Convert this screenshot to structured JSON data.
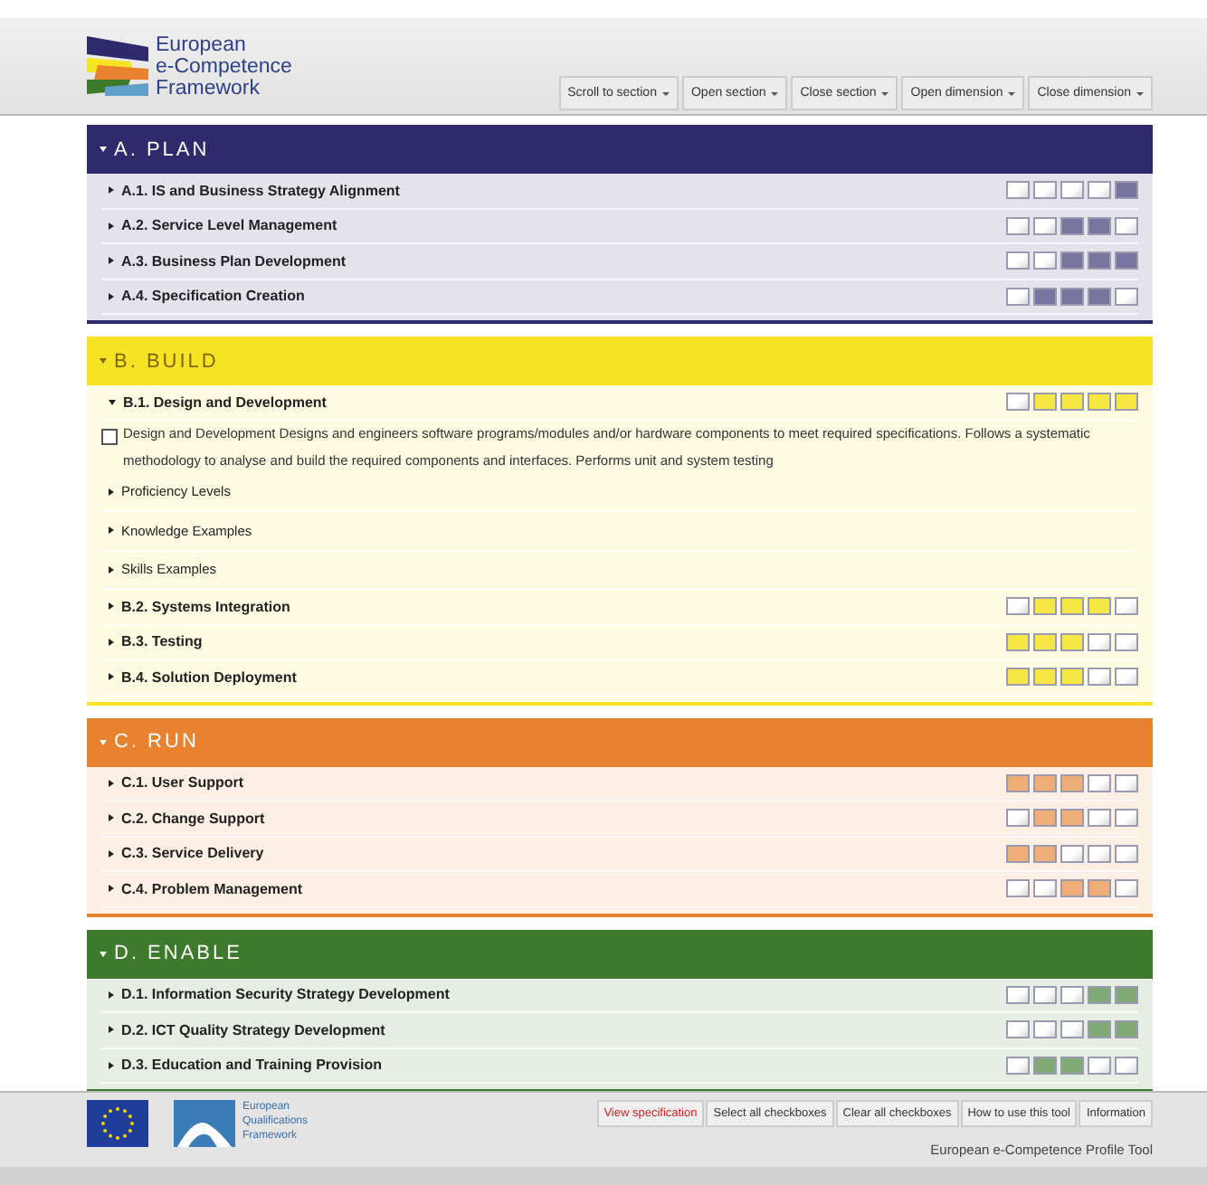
{
  "header": {
    "logo_lines": [
      "European",
      "e-Competence",
      "Framework"
    ],
    "menu_buttons": [
      "Scroll to section",
      "Open section",
      "Close section",
      "Open dimension",
      "Close dimension"
    ]
  },
  "sections": [
    {
      "title": "A. PLAN",
      "color": "#2e2a6b",
      "expanded": true,
      "items": [
        {
          "title": "A.1. IS and Business Strategy Alignment",
          "expanded": false,
          "levels": [
            false,
            false,
            false,
            false,
            true
          ]
        },
        {
          "title": "A.2. Service Level Management",
          "expanded": false,
          "levels": [
            false,
            false,
            true,
            true,
            false
          ]
        },
        {
          "title": "A.3. Business Plan Development",
          "expanded": false,
          "levels": [
            false,
            false,
            true,
            true,
            true
          ]
        },
        {
          "title": "A.4. Specification Creation",
          "expanded": false,
          "levels": [
            false,
            true,
            true,
            true,
            false
          ]
        }
      ]
    },
    {
      "title": "B. BUILD",
      "color": "#f5e324",
      "expanded": true,
      "items": [
        {
          "title": "B.1. Design and Development",
          "expanded": true,
          "levels": [
            false,
            true,
            true,
            true,
            true
          ],
          "description": "Design and Development Designs and engineers software programs/modules and/or hardware components to meet required specifications. Follows a systematic methodology to analyse and build the required components and interfaces. Performs unit and system testing",
          "description_checked": false,
          "subsections": [
            "Proficiency Levels",
            "Knowledge Examples",
            "Skills Examples"
          ]
        },
        {
          "title": "B.2. Systems Integration",
          "expanded": false,
          "levels": [
            false,
            true,
            true,
            true,
            false
          ]
        },
        {
          "title": "B.3. Testing",
          "expanded": false,
          "levels": [
            true,
            true,
            true,
            false,
            false
          ]
        },
        {
          "title": "B.4. Solution Deployment",
          "expanded": false,
          "levels": [
            true,
            true,
            true,
            false,
            false
          ]
        }
      ]
    },
    {
      "title": "C. RUN",
      "color": "#e8822e",
      "expanded": true,
      "items": [
        {
          "title": "C.1. User Support",
          "expanded": false,
          "levels": [
            true,
            true,
            true,
            false,
            false
          ]
        },
        {
          "title": "C.2. Change Support",
          "expanded": false,
          "levels": [
            false,
            true,
            true,
            false,
            false
          ]
        },
        {
          "title": "C.3. Service Delivery",
          "expanded": false,
          "levels": [
            true,
            true,
            false,
            false,
            false
          ]
        },
        {
          "title": "C.4. Problem Management",
          "expanded": false,
          "levels": [
            false,
            false,
            true,
            true,
            false
          ]
        }
      ]
    },
    {
      "title": "D. ENABLE",
      "color": "#3d7a2c",
      "expanded": true,
      "items": [
        {
          "title": "D.1. Information Security Strategy Development",
          "expanded": false,
          "levels": [
            false,
            false,
            false,
            true,
            true
          ]
        },
        {
          "title": "D.2. ICT Quality Strategy Development",
          "expanded": false,
          "levels": [
            false,
            false,
            false,
            true,
            true
          ]
        },
        {
          "title": "D.3. Education and Training Provision",
          "expanded": false,
          "levels": [
            false,
            true,
            true,
            false,
            false
          ]
        }
      ]
    }
  ],
  "footer": {
    "eqf_lines": [
      "European",
      "Qualifications",
      "Framework"
    ],
    "buttons": [
      {
        "label": "View specification",
        "highlighted": true
      },
      {
        "label": "Select all checkboxes",
        "highlighted": false
      },
      {
        "label": "Clear all checkboxes",
        "highlighted": false
      },
      {
        "label": "How to use this tool",
        "highlighted": false
      },
      {
        "label": "Information",
        "highlighted": false
      }
    ],
    "tool_title": "European e-Competence Profile Tool"
  }
}
